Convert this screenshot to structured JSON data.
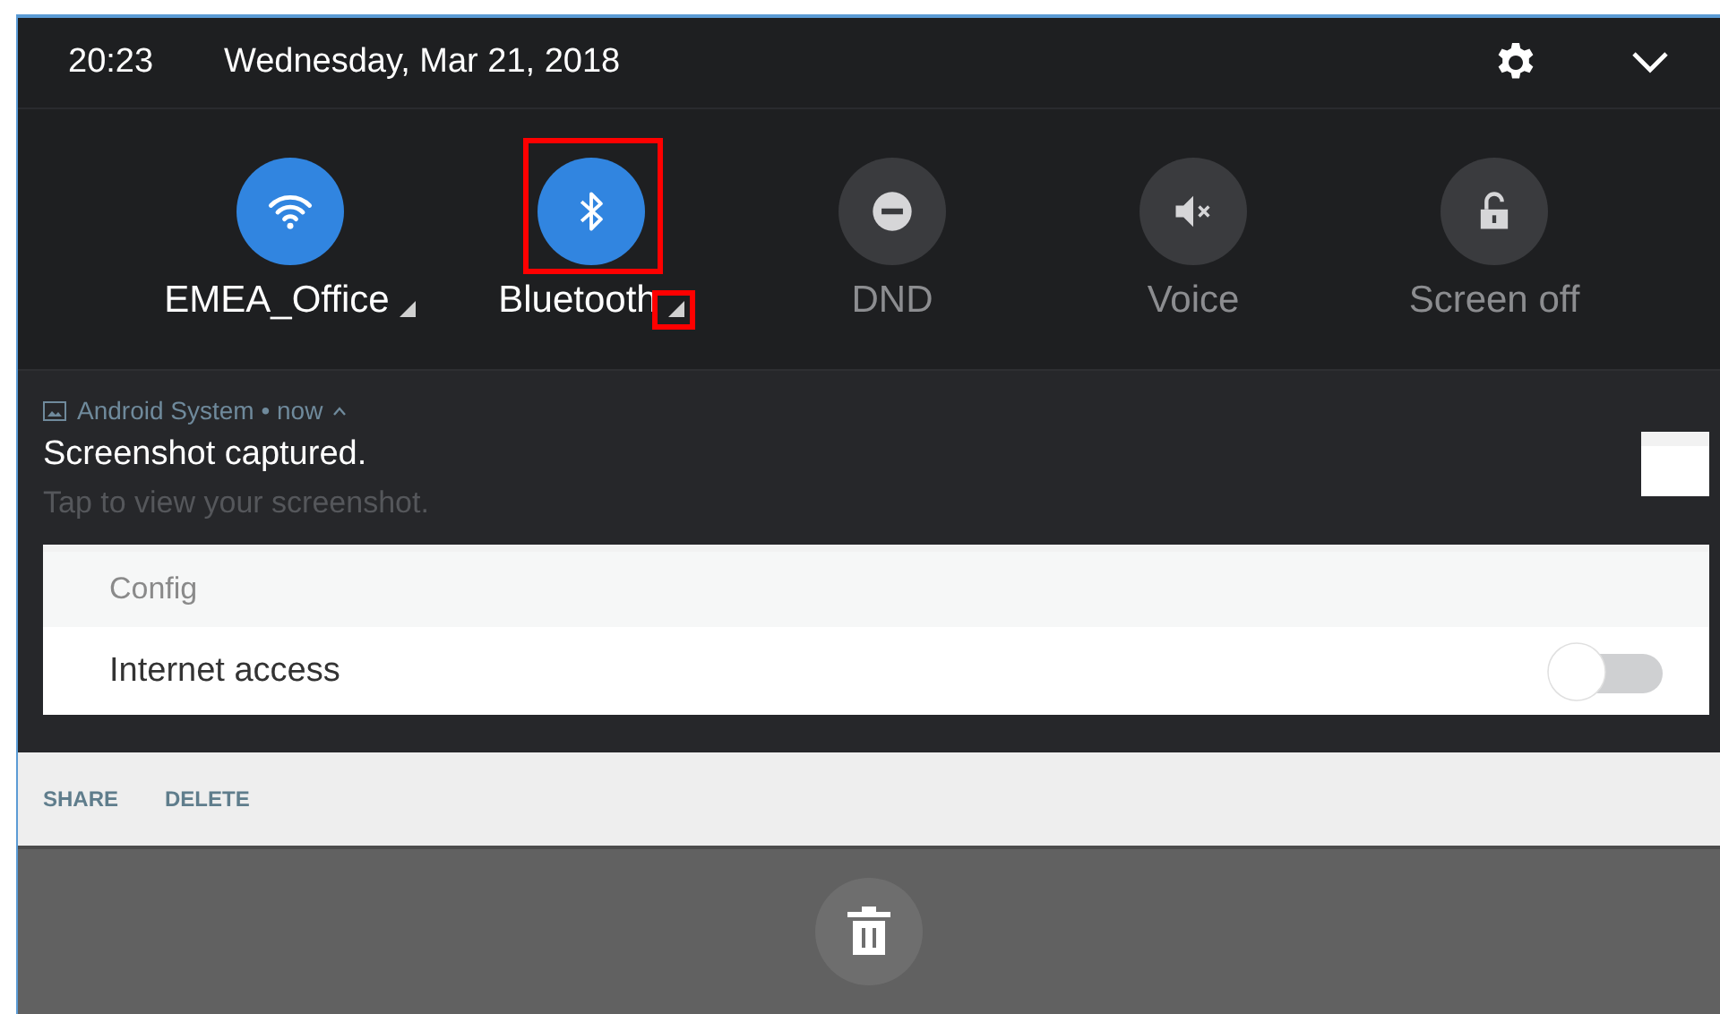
{
  "status_header": {
    "time": "20:23",
    "date": "Wednesday, Mar 21, 2018"
  },
  "tiles": [
    {
      "kind": "wifi",
      "label": "EMEA_Office",
      "on": true,
      "has_menu": true,
      "highlighted": false
    },
    {
      "kind": "bluetooth",
      "label": "Bluetooth",
      "on": true,
      "has_menu": true,
      "highlighted": true
    },
    {
      "kind": "dnd",
      "label": "DND",
      "on": false,
      "has_menu": false,
      "highlighted": false
    },
    {
      "kind": "voice",
      "label": "Voice",
      "on": false,
      "has_menu": false,
      "highlighted": false
    },
    {
      "kind": "lock",
      "label": "Screen off",
      "on": false,
      "has_menu": false,
      "highlighted": false
    }
  ],
  "notification": {
    "app": "Android System • now",
    "title": "Screenshot captured.",
    "text": "Tap to view your screenshot.",
    "preview": {
      "section": "Config",
      "setting": {
        "label": "Internet access",
        "on": false
      }
    },
    "actions": [
      "SHARE",
      "DELETE"
    ]
  }
}
